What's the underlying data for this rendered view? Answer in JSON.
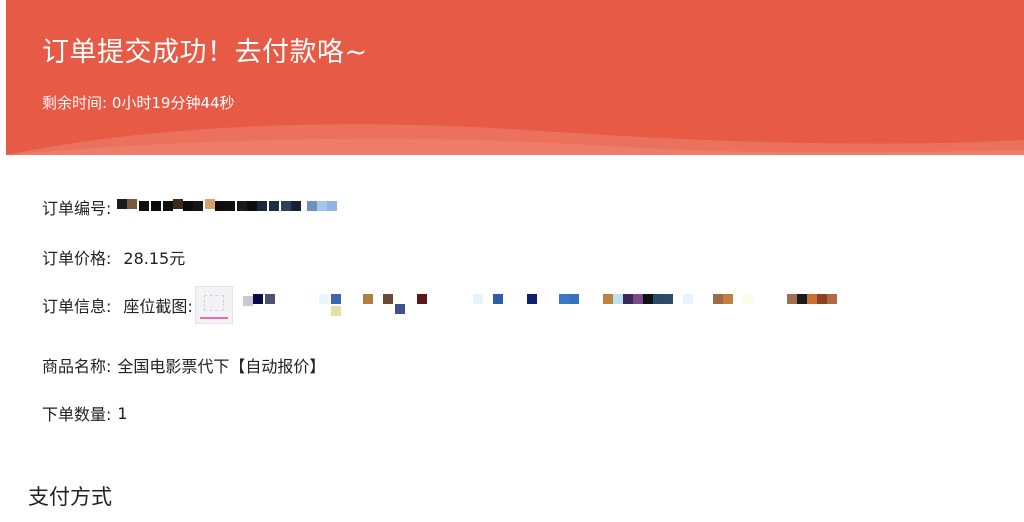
{
  "header": {
    "title": "订单提交成功！去付款咯~",
    "remaining_label": "剩余时间:",
    "remaining_value": "0小时19分钟44秒",
    "colors": {
      "banner": "#e75a46",
      "wave": "#ee7a66"
    }
  },
  "order": {
    "number_label": "订单编号:",
    "price_label": "订单价格:",
    "price_value": "28.15元",
    "info_label": "订单信息:",
    "info_value": "座位截图:",
    "product_label": "商品名称:",
    "product_value": "全国电影票代下【自动报价】",
    "quantity_label": "下单数量:",
    "quantity_value": "1"
  },
  "payment": {
    "section_title": "支付方式"
  }
}
